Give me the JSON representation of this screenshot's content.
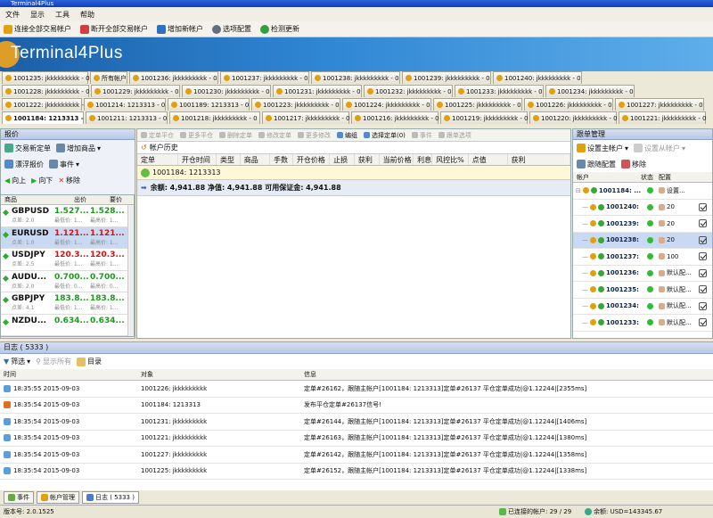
{
  "window": {
    "title": "Terminal4Plus"
  },
  "menu": [
    "文件",
    "显示",
    "工具",
    "帮助"
  ],
  "toolbar": [
    {
      "label": "连接全部交易帐户",
      "icon": "connect-icon",
      "color": "#e0a010"
    },
    {
      "label": "断开全部交易帐户",
      "icon": "disconnect-icon",
      "color": "#d04040"
    },
    {
      "label": "增加新帐户",
      "icon": "add-account-icon",
      "color": "#3070c0"
    },
    {
      "label": "选项配置",
      "icon": "gear-icon",
      "color": "#607080"
    },
    {
      "label": "检测更新",
      "icon": "update-icon",
      "color": "#30a040"
    }
  ],
  "banner": {
    "logo": "Terminal4Plus"
  },
  "tabs_row1": [
    "1001235: jkkkkkkkkk - 0",
    "所有帐户",
    "1001236: jkkkkkkkkk - 0",
    "1001237: jkkkkkkkkk - 0",
    "1001238: jkkkkkkkkk - 0",
    "1001239: jkkkkkkkkk - 0",
    "1001240: jkkkkkkkkk - 0"
  ],
  "tabs_row2": [
    "1001228: jkkkkkkkkk - 0",
    "1001229: jkkkkkkkkk - 0",
    "1001230: jkkkkkkkkk - 0",
    "1001231: jkkkkkkkkk - 0",
    "1001232: jkkkkkkkkk - 0",
    "1001233: jkkkkkkkkk - 0",
    "1001234: jkkkkkkkkk - 0"
  ],
  "tabs_row3": [
    "1001222: jkkkkkkkkk - 0",
    "1001214: 1213313 - 0",
    "1001189: 1213313 - 0",
    "1001223: jkkkkkkkkk - 0",
    "1001224: jkkkkkkkkk - 0",
    "1001225: jkkkkkkkkk - 0",
    "1001226: jkkkkkkkkk - 0",
    "1001227: jkkkkkkkkk - 0"
  ],
  "tabs_row4": [
    "1001184: 1213313 - 0",
    "1001211: 1213313 - 0",
    "1001218: jkkkkkkkkk - 0",
    "1001217: jkkkkkkkkk - 0",
    "1001216: jkkkkkkkkk - 0",
    "1001219: jkkkkkkkkk - 0",
    "1001220: jkkkkkkkkk - 0",
    "1001221: jkkkkkkkkk - 0"
  ],
  "quote_panel": {
    "title": "报价",
    "new_order": "交易新定单",
    "add_symbol": "增加商品",
    "float": "漂浮报价",
    "events": "事件",
    "up": "向上",
    "down": "向下",
    "remove": "移除",
    "col_symbol": "商品",
    "col_bid": "出价",
    "col_ask": "要价"
  },
  "quotes": [
    {
      "symbol": "GBPUSD",
      "spread": "点差: 2.0",
      "bid": "1.527...",
      "ask": "1.528...",
      "bid_sub": "最低价: 1...",
      "ask_sub": "最高价: 1...",
      "color": "green"
    },
    {
      "symbol": "EURUSD",
      "spread": "点差: 1.0",
      "bid": "1.121...",
      "ask": "1.121...",
      "bid_sub": "最低价: 1...",
      "ask_sub": "最高价: 1...",
      "color": "red"
    },
    {
      "symbol": "USDJPY",
      "spread": "点差: 2.5",
      "bid": "120.3...",
      "ask": "120.3...",
      "bid_sub": "最低价: 1...",
      "ask_sub": "最高价: 1...",
      "color": "red"
    },
    {
      "symbol": "AUDU...",
      "spread": "点差: 2.0",
      "bid": "0.700...",
      "ask": "0.700...",
      "bid_sub": "最低价: 0...",
      "ask_sub": "最高价: 0...",
      "color": "green"
    },
    {
      "symbol": "GBPJPY",
      "spread": "点差: 4.1",
      "bid": "183.8...",
      "ask": "183.8...",
      "bid_sub": "最低价: 1...",
      "ask_sub": "最高价: 1...",
      "color": "green"
    },
    {
      "symbol": "NZDU...",
      "spread": "",
      "bid": "0.634...",
      "ask": "0.634...",
      "bid_sub": "",
      "ask_sub": "",
      "color": "green"
    }
  ],
  "orders_toolbar": [
    "定单平仓",
    "更多平仓",
    "删除定单",
    "修改定单",
    "更多修改",
    "编组",
    "选择定单(0)",
    "事件",
    "跟单选项"
  ],
  "account_history": "帐户历史",
  "orders_cols": [
    "定单",
    "开仓时间",
    "类型",
    "商品",
    "手数",
    "开仓价格",
    "止损",
    "获利",
    "当前价格",
    "利息",
    "风控比%",
    "点值",
    "获利"
  ],
  "account_line": "1001184: 1213313",
  "balance_line": "余额: 4,941.88   净值: 4,941.88   可用保证金: 4,941.88",
  "follow_panel": {
    "title": "跟单管理",
    "set_main": "设置主帐户",
    "set_follow": "设置从帐户",
    "config": "跟随配置",
    "remove": "移除",
    "col_account": "帐户",
    "col_state": "状态",
    "col_config": "配置"
  },
  "follow_accounts": [
    {
      "id": "1001184: ...",
      "config": "设置...",
      "main": true
    },
    {
      "id": "1001240: ...",
      "config": "20"
    },
    {
      "id": "1001239: ...",
      "config": "20"
    },
    {
      "id": "1001238: ...",
      "config": "20"
    },
    {
      "id": "1001237: ...",
      "config": "100"
    },
    {
      "id": "1001236: ...",
      "config": "默认配..."
    },
    {
      "id": "1001235: ...",
      "config": "默认配..."
    },
    {
      "id": "1001234: ...",
      "config": "默认配..."
    },
    {
      "id": "1001233: ...",
      "config": "默认配..."
    }
  ],
  "log": {
    "title": "日志 ( 5333 )",
    "filter": "筛选",
    "show_all": "显示所有",
    "folder": "目录",
    "col_time": "时间",
    "col_object": "对象",
    "col_info": "信息"
  },
  "log_rows": [
    {
      "time": "18:35:55 2015-09-03",
      "object": "1001226: jkkkkkkkkk",
      "info": "定单#26162，跟随主帐户[1001184: 1213313]定单#26137 平仓定单成功|@1.12244|[2355ms]"
    },
    {
      "time": "18:35:54 2015-09-03",
      "object": "1001184: 1213313",
      "info": "发布平仓定单#26137信号!"
    },
    {
      "time": "18:35:54 2015-09-03",
      "object": "1001231: jkkkkkkkkk",
      "info": "定单#26144，跟随主帐户[1001184: 1213313]定单#26137 平仓定单成功|@1.12244|[1406ms]"
    },
    {
      "time": "18:35:54 2015-09-03",
      "object": "1001221: jkkkkkkkkk",
      "info": "定单#26163，跟随主帐户[1001184: 1213313]定单#26137 平仓定单成功|@1.12244|[1380ms]"
    },
    {
      "time": "18:35:54 2015-09-03",
      "object": "1001227: jkkkkkkkkk",
      "info": "定单#26142，跟随主帐户[1001184: 1213313]定单#26137 平仓定单成功|@1.12244|[1358ms]"
    },
    {
      "time": "18:35:54 2015-09-03",
      "object": "1001225: jkkkkkkkkk",
      "info": "定单#26152，跟随主帐户[1001184: 1213313]定单#26137 平仓定单成功|@1.12244|[1338ms]"
    }
  ],
  "bottom_tabs": [
    "事件",
    "帐户管理",
    "日志 ( 5333 )"
  ],
  "status": {
    "version": "版本号: 2.0.1525",
    "connected": "已连接的帐户: 29 / 29",
    "balance": "余额: USD=143345.67"
  }
}
